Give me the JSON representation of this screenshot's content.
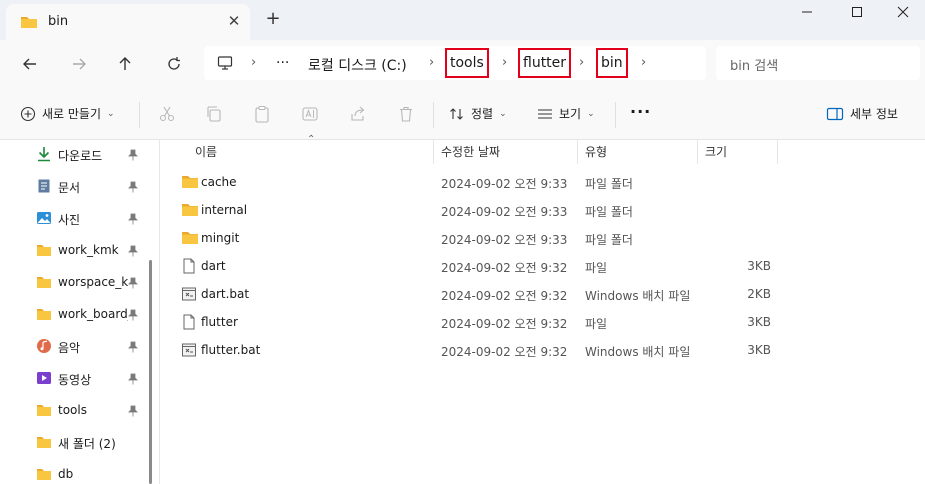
{
  "tab": {
    "title": "bin",
    "close": "✕",
    "new_tab": "+"
  },
  "window": {
    "minimize": "—",
    "maximize": "☐",
    "close": "✕"
  },
  "address": {
    "ellipsis": "···",
    "crumbs": [
      "로컬 디스크 (C:)",
      "tools",
      "flutter",
      "bin"
    ],
    "sep": "›"
  },
  "search": {
    "placeholder": "bin 검색"
  },
  "toolbar": {
    "new_label": "새로 만들기",
    "sort_label": "정렬",
    "view_label": "보기",
    "more": "···",
    "details_label": "세부 정보",
    "chev": "⌄"
  },
  "sidebar": {
    "items": [
      {
        "label": "다운로드",
        "icon": "download-icon",
        "pinned": true
      },
      {
        "label": "문서",
        "icon": "document-icon",
        "pinned": true
      },
      {
        "label": "사진",
        "icon": "pictures-icon",
        "pinned": true
      },
      {
        "label": "work_kmk",
        "icon": "folder-icon",
        "pinned": true
      },
      {
        "label": "worspace_km",
        "icon": "folder-icon",
        "pinned": true
      },
      {
        "label": "work_board_",
        "icon": "folder-icon",
        "pinned": true
      },
      {
        "label": "음악",
        "icon": "music-icon",
        "pinned": true
      },
      {
        "label": "동영상",
        "icon": "video-icon",
        "pinned": true
      },
      {
        "label": "tools",
        "icon": "folder-icon",
        "pinned": true
      },
      {
        "label": "새 폴더 (2)",
        "icon": "folder-icon",
        "pinned": false
      },
      {
        "label": "db",
        "icon": "folder-icon",
        "pinned": false
      }
    ]
  },
  "columns": {
    "name": "이름",
    "modified": "수정한 날짜",
    "type": "유형",
    "size": "크기"
  },
  "files": [
    {
      "name": "cache",
      "modified": "2024-09-02 오전 9:33",
      "type": "파일 폴더",
      "size": "",
      "kind": "folder"
    },
    {
      "name": "internal",
      "modified": "2024-09-02 오전 9:33",
      "type": "파일 폴더",
      "size": "",
      "kind": "folder"
    },
    {
      "name": "mingit",
      "modified": "2024-09-02 오전 9:33",
      "type": "파일 폴더",
      "size": "",
      "kind": "folder"
    },
    {
      "name": "dart",
      "modified": "2024-09-02 오전 9:32",
      "type": "파일",
      "size": "3KB",
      "kind": "file"
    },
    {
      "name": "dart.bat",
      "modified": "2024-09-02 오전 9:32",
      "type": "Windows 배치 파일",
      "size": "2KB",
      "kind": "bat"
    },
    {
      "name": "flutter",
      "modified": "2024-09-02 오전 9:32",
      "type": "파일",
      "size": "3KB",
      "kind": "file"
    },
    {
      "name": "flutter.bat",
      "modified": "2024-09-02 오전 9:32",
      "type": "Windows 배치 파일",
      "size": "3KB",
      "kind": "bat"
    }
  ],
  "colors": {
    "folder": "#f8c640",
    "folder_dark": "#e8a92c",
    "highlight": "#e2001a",
    "accent": "#0067c0"
  }
}
